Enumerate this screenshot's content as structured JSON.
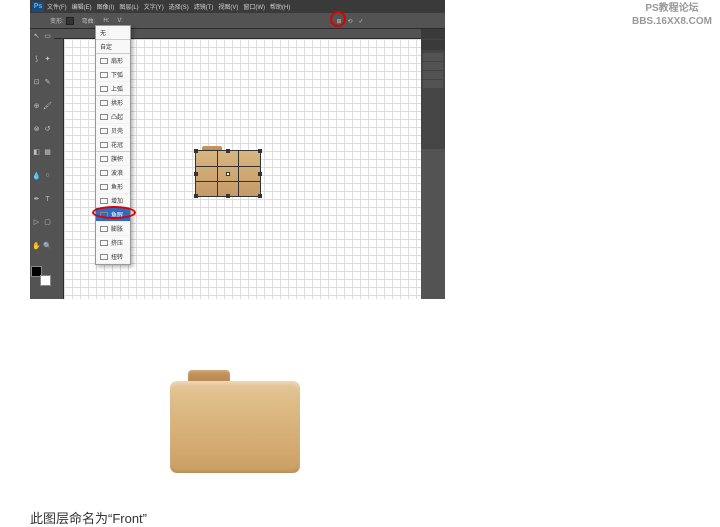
{
  "watermark": {
    "line1": "PS教程论坛",
    "line2": "BBS.16XX8.COM"
  },
  "ps": {
    "logo": "Ps",
    "menu": [
      "文件(F)",
      "编辑(E)",
      "图像(I)",
      "图层(L)",
      "文字(Y)",
      "选择(S)",
      "滤镜(T)",
      "视图(V)",
      "窗口(W)",
      "帮助(H)"
    ],
    "optionsBar": {
      "warpLabel": "变形:",
      "bendLabel": "弯曲:",
      "hLabel": "H:",
      "vLabel": "V:"
    },
    "warpControls": {
      "grid": "⊞",
      "orient": "⟲",
      "confirm": "✓"
    }
  },
  "warp_dropdown": [
    {
      "label": "无",
      "icon": false,
      "sep": true
    },
    {
      "label": "自定",
      "icon": false,
      "sep": true
    },
    {
      "label": "扇形",
      "icon": true
    },
    {
      "label": "下弧",
      "icon": true
    },
    {
      "label": "上弧",
      "icon": true,
      "sep": true
    },
    {
      "label": "拱形",
      "icon": true
    },
    {
      "label": "凸起",
      "icon": true
    },
    {
      "label": "贝壳",
      "icon": true
    },
    {
      "label": "花冠",
      "icon": true,
      "sep": true
    },
    {
      "label": "旗帜",
      "icon": true
    },
    {
      "label": "波浪",
      "icon": true
    },
    {
      "label": "鱼形",
      "icon": true
    },
    {
      "label": "增加",
      "icon": true,
      "sep": true
    },
    {
      "label": "鱼眼",
      "icon": true,
      "highlighted": true
    },
    {
      "label": "膨胀",
      "icon": true
    },
    {
      "label": "挤压",
      "icon": true
    },
    {
      "label": "扭转",
      "icon": true
    }
  ],
  "caption": "此图层命名为“Front”"
}
